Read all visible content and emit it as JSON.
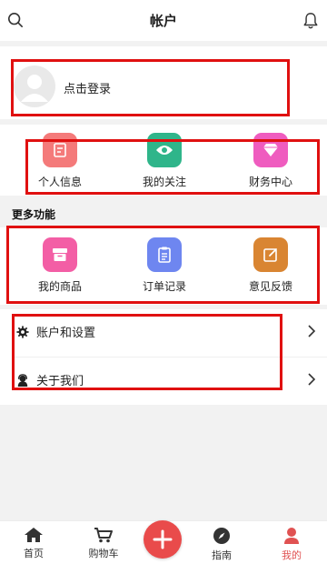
{
  "header": {
    "title": "帐户"
  },
  "login": {
    "label": "点击登录"
  },
  "quick_links": [
    {
      "label": "个人信息",
      "color": "#f47a7a",
      "icon": "note-icon"
    },
    {
      "label": "我的关注",
      "color": "#2fb58a",
      "icon": "eye-icon"
    },
    {
      "label": "财务中心",
      "color": "#ef5cbf",
      "icon": "diamond-icon"
    }
  ],
  "more": {
    "title": "更多功能",
    "items": [
      {
        "label": "我的商品",
        "color": "#f35ea5",
        "icon": "box-icon"
      },
      {
        "label": "订单记录",
        "color": "#6e86f0",
        "icon": "clipboard-icon"
      },
      {
        "label": "意见反馈",
        "color": "#d98532",
        "icon": "edit-icon"
      }
    ]
  },
  "settings": [
    {
      "label": "账户和设置",
      "icon": "gear-icon"
    },
    {
      "label": "关于我们",
      "icon": "support-icon"
    }
  ],
  "tabs": [
    {
      "label": "首页",
      "icon": "home-icon"
    },
    {
      "label": "购物车",
      "icon": "cart-icon"
    },
    {
      "label": "指南",
      "icon": "compass-icon"
    },
    {
      "label": "我的",
      "icon": "person-icon",
      "active": true
    }
  ],
  "colors": {
    "highlight": "#e01010",
    "accent": "#e94b4b"
  }
}
